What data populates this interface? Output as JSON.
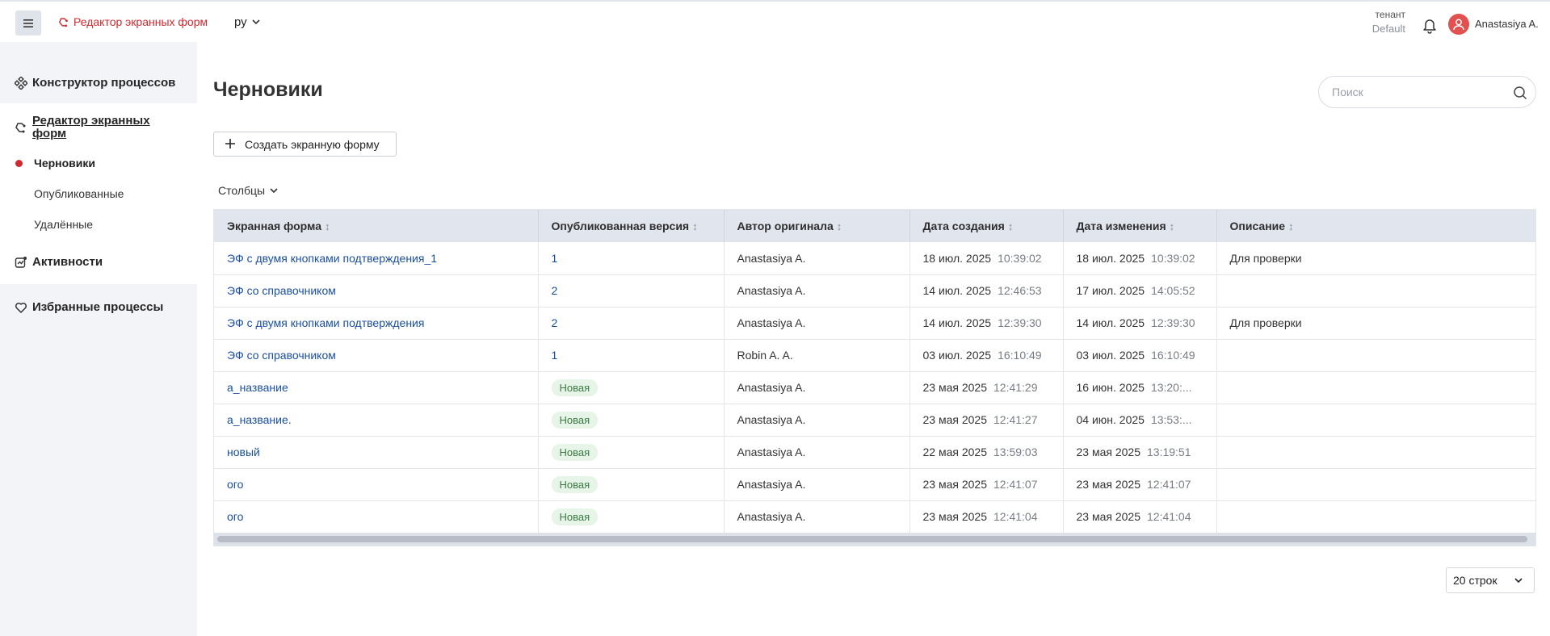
{
  "topbar": {
    "brand": "Редактор экранных форм",
    "lang": "ру",
    "tenant_label": "тенант",
    "tenant_value": "Default",
    "user": "Anastasiya A."
  },
  "sidebar": {
    "items": [
      {
        "label": "Конструктор процессов",
        "icon": "process-icon"
      },
      {
        "label": "Редактор экранных форм",
        "icon": "form-editor-icon"
      },
      {
        "label": "Активности",
        "icon": "activity-icon"
      },
      {
        "label": "Избранные процессы",
        "icon": "heart-icon"
      }
    ],
    "sub_items": [
      {
        "label": "Черновики"
      },
      {
        "label": "Опубликованные"
      },
      {
        "label": "Удалённые"
      }
    ]
  },
  "main": {
    "title": "Черновики",
    "search_placeholder": "Поиск",
    "create_label": "Создать экранную форму",
    "columns_label": "Столбцы",
    "rows_per_page": "20 строк"
  },
  "table": {
    "sort_icon": "↕",
    "headers": [
      "Экранная форма",
      "Опубликованная версия",
      "Автор оригинала",
      "Дата создания",
      "Дата изменения",
      "Описание"
    ],
    "rows": [
      {
        "name": "ЭФ с двумя кнопками подтверждения_1",
        "version": "1",
        "author": "Anastasiya A.",
        "created_date": "18 июл. 2025",
        "created_time": "10:39:02",
        "modified_date": "18 июл. 2025",
        "modified_time": "10:39:02",
        "description": "Для проверки"
      },
      {
        "name": "ЭФ со справочником",
        "version": "2",
        "author": "Anastasiya A.",
        "created_date": "14 июл. 2025",
        "created_time": "12:46:53",
        "modified_date": "17 июл. 2025",
        "modified_time": "14:05:52",
        "description": ""
      },
      {
        "name": "ЭФ с двумя кнопками подтверждения",
        "version": "2",
        "author": "Anastasiya A.",
        "created_date": "14 июл. 2025",
        "created_time": "12:39:30",
        "modified_date": "14 июл. 2025",
        "modified_time": "12:39:30",
        "description": "Для проверки"
      },
      {
        "name": "ЭФ со справочником",
        "version": "1",
        "author": "Robin A. A.",
        "created_date": "03 июл. 2025",
        "created_time": "16:10:49",
        "modified_date": "03 июл. 2025",
        "modified_time": "16:10:49",
        "description": ""
      },
      {
        "name": "а_название",
        "version": "Новая",
        "author": "Anastasiya A.",
        "created_date": "23 мая 2025",
        "created_time": "12:41:29",
        "modified_date": "16 июн. 2025",
        "modified_time": "13:20:...",
        "description": ""
      },
      {
        "name": "а_название.",
        "version": "Новая",
        "author": "Anastasiya A.",
        "created_date": "23 мая 2025",
        "created_time": "12:41:27",
        "modified_date": "04 июн. 2025",
        "modified_time": "13:53:...",
        "description": ""
      },
      {
        "name": "новый",
        "version": "Новая",
        "author": "Anastasiya A.",
        "created_date": "22 мая 2025",
        "created_time": "13:59:03",
        "modified_date": "23 мая 2025",
        "modified_time": "13:19:51",
        "description": ""
      },
      {
        "name": "ого",
        "version": "Новая",
        "author": "Anastasiya A.",
        "created_date": "23 мая 2025",
        "created_time": "12:41:07",
        "modified_date": "23 мая 2025",
        "modified_time": "12:41:07",
        "description": ""
      },
      {
        "name": "ого",
        "version": "Новая",
        "author": "Anastasiya A.",
        "created_date": "23 мая 2025",
        "created_time": "12:41:04",
        "modified_date": "23 мая 2025",
        "modified_time": "12:41:04",
        "description": ""
      }
    ]
  },
  "colors": {
    "accent": "#d1292f",
    "link": "#1a4fa0",
    "header_bg": "#e1e5ee",
    "sidebar_bg": "#f3f4f8",
    "badge_bg": "#e6f5e8",
    "badge_text": "#3a7a45"
  }
}
